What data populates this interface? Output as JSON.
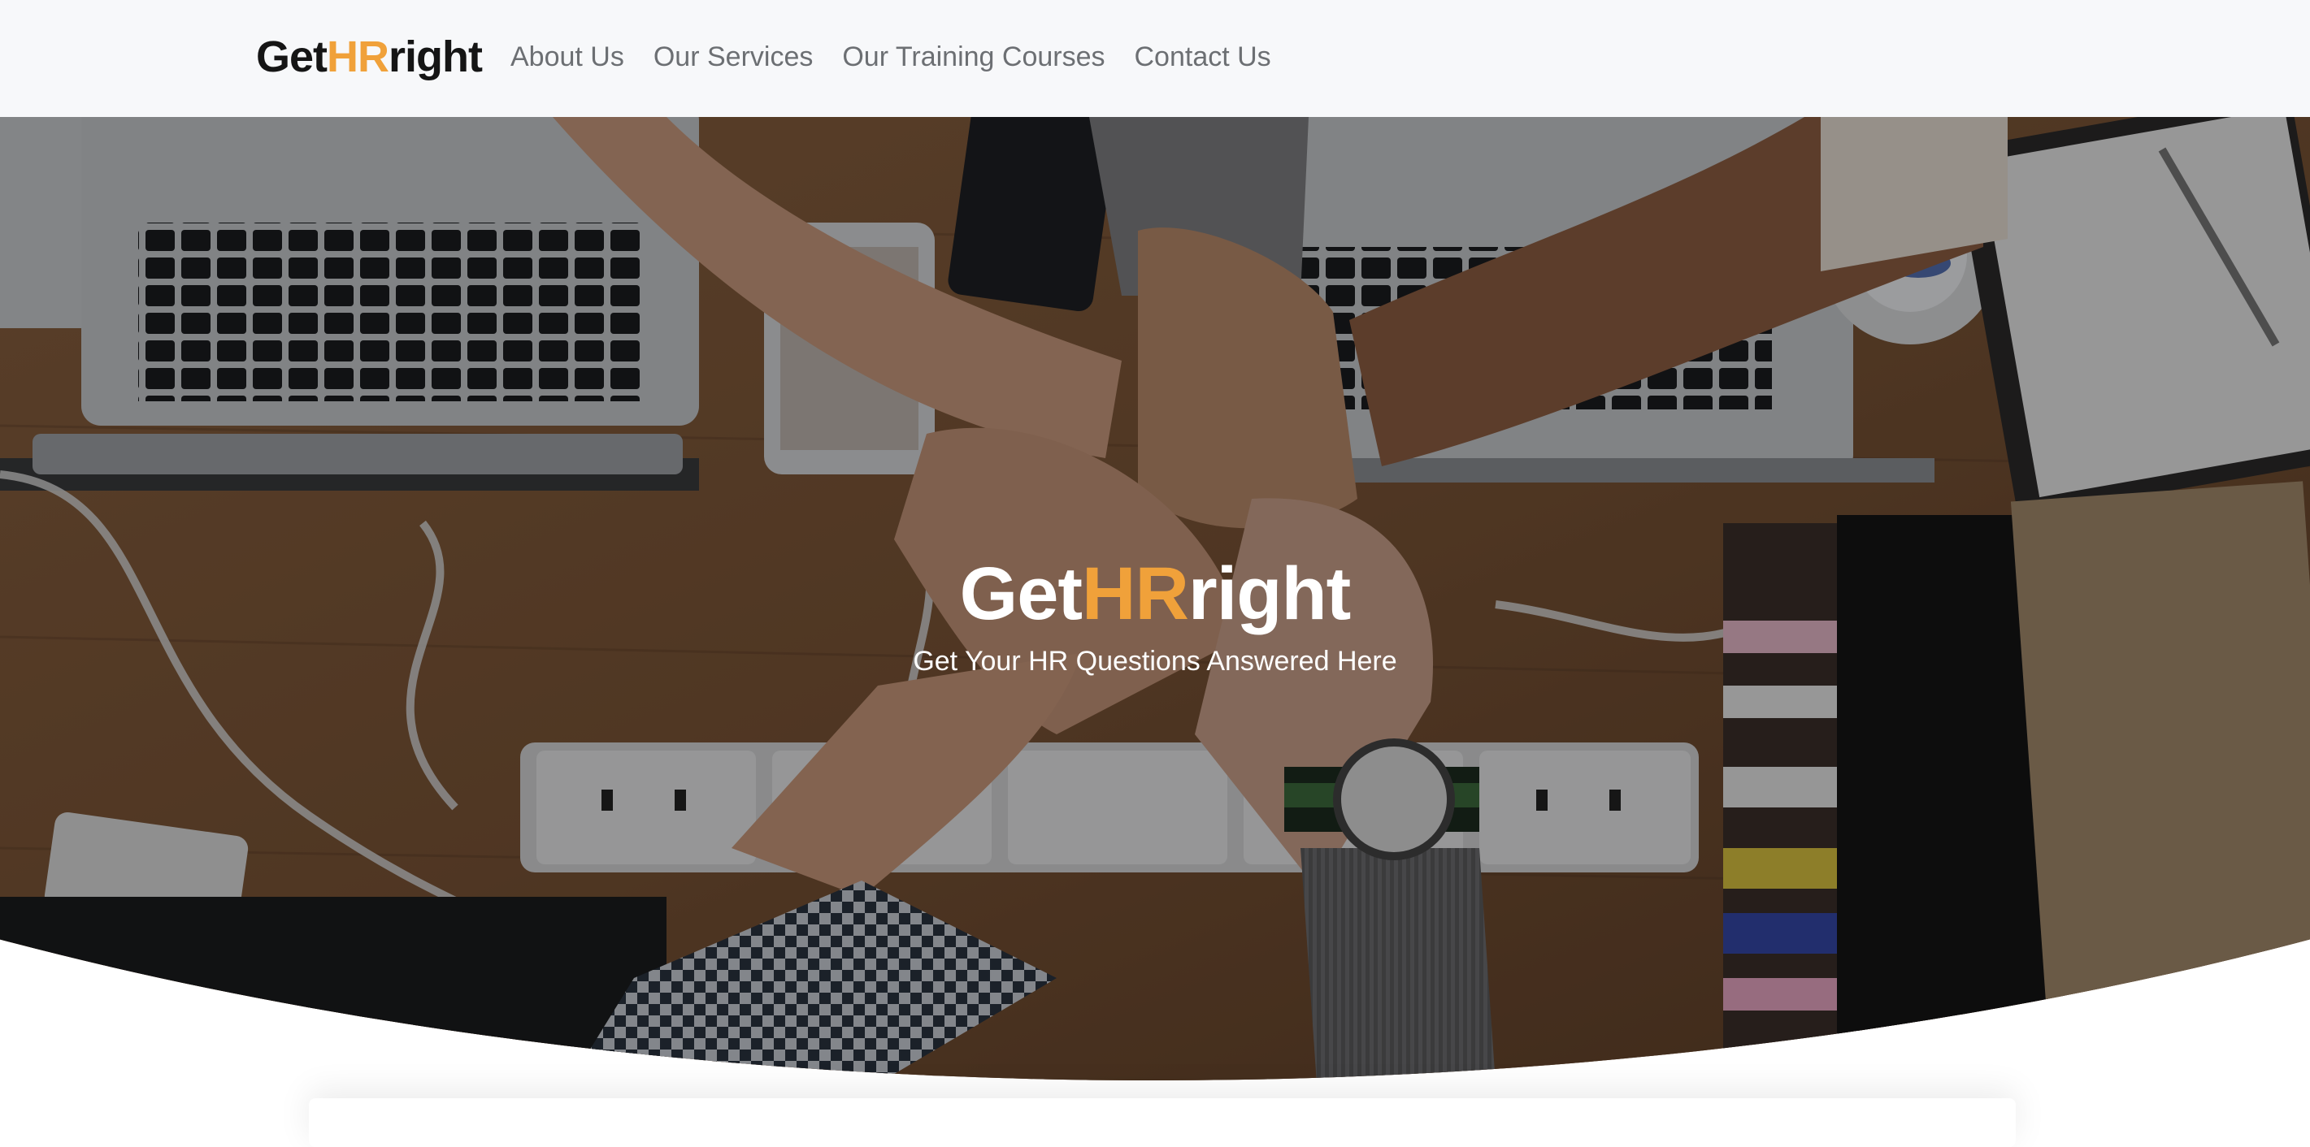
{
  "navbar": {
    "brand": {
      "prefix": "Get",
      "highlight": "HR",
      "suffix": "right"
    },
    "links": [
      {
        "label": "About Us"
      },
      {
        "label": "Our Services"
      },
      {
        "label": "Our Training Courses"
      },
      {
        "label": "Contact Us"
      }
    ]
  },
  "hero": {
    "title": {
      "prefix": "Get",
      "highlight": "HR",
      "suffix": "right"
    },
    "subtitle": "Get Your HR Questions Answered Here"
  },
  "colors": {
    "accent": "#f0a13a",
    "navbar_bg": "#f7f8fa",
    "nav_text": "#6c6f73",
    "brand_text": "#151515"
  }
}
